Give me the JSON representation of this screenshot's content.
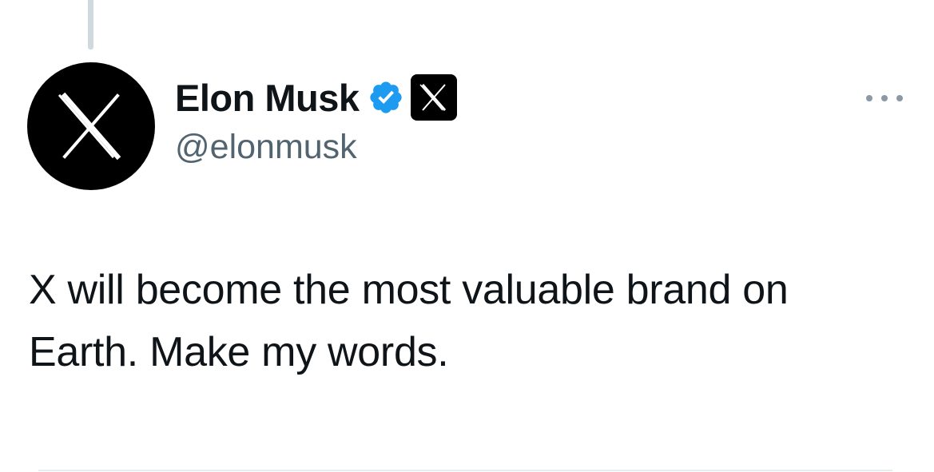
{
  "author": {
    "display_name": "Elon Musk",
    "handle": "@elonmusk",
    "verified_icon": "verified-badge-icon",
    "affiliate_icon": "x-logo-icon",
    "avatar_icon": "x-logo-icon"
  },
  "actions": {
    "more_icon": "more-options-icon"
  },
  "tweet": {
    "text": "X will become the most valuable brand on Earth. Make my words."
  },
  "colors": {
    "verified_blue": "#1d9bf0",
    "text_primary": "#0f1419",
    "text_secondary": "#536471",
    "avatar_bg": "#000000"
  }
}
